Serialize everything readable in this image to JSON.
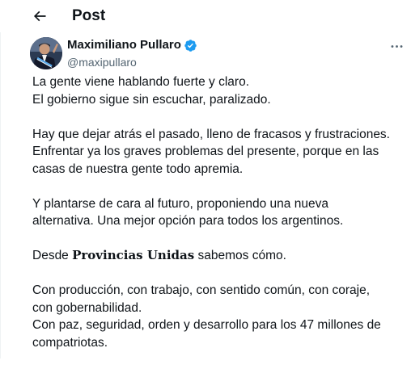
{
  "header": {
    "title": "Post",
    "back_icon": "arrow-left-icon"
  },
  "author": {
    "display_name": "Maximiliano Pullaro",
    "handle": "@maxipullaro",
    "verified": true,
    "verified_color": "#1d9bf0",
    "avatar_icon": "profile-photo"
  },
  "more_icon": "more-horizontal-icon",
  "tweet": {
    "paragraphs": [
      {
        "lines": [
          "La gente viene hablando fuerte y claro.",
          "El gobierno sigue sin escuchar, paralizado."
        ]
      },
      {
        "lines": [
          "Hay que dejar atrás el pasado, lleno de fracasos y frustraciones.",
          "Enfrentar ya los graves problemas del presente, porque en las",
          "casas de nuestra gente todo apremia."
        ]
      },
      {
        "lines": [
          "Y plantarse de cara al futuro, proponiendo una nueva",
          "alternativa. Una mejor opción para todos los argentinos."
        ]
      },
      {
        "prefix": "Desde ",
        "bold": "Provincias Unidas",
        "suffix": " sabemos cómo."
      },
      {
        "lines": [
          "Con producción, con trabajo, con sentido común, con coraje,",
          "con gobernabilidad.",
          "Con paz, seguridad, orden y desarrollo para los 47 millones de",
          "compatriotas."
        ]
      }
    ]
  }
}
